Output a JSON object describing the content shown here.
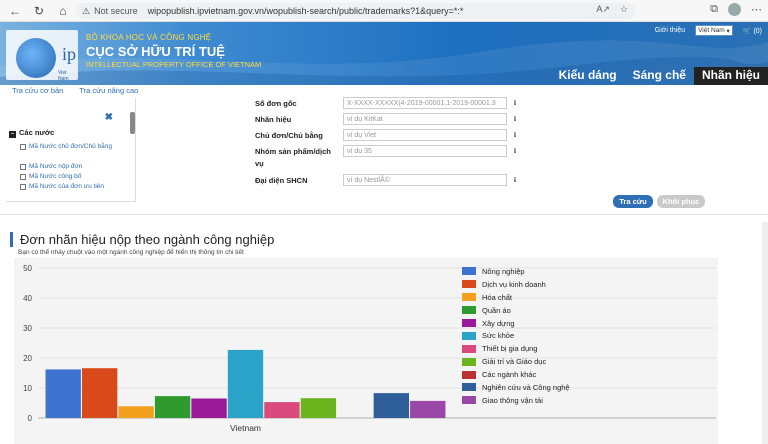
{
  "browser": {
    "not_secure": "Not secure",
    "url": "wipopublish.ipvietnam.gov.vn/wopublish-search/public/trademarks?1&query=*:*"
  },
  "header": {
    "logo_text": "ip",
    "logo_sub": "Viet Nam",
    "org_line1": "BỘ KHOA HỌC VÀ CÔNG NGHỆ",
    "org_line2": "CỤC SỞ HỮU TRÍ TUỆ",
    "org_line3": "INTELLECTUAL PROPERTY OFFICE OF VIETNAM",
    "about": "Giới thiệu",
    "language": "Việt Nam",
    "cart": "(0)",
    "tabs": [
      {
        "label": "Kiểu dáng"
      },
      {
        "label": "Sáng chế"
      },
      {
        "label": "Nhãn hiệu"
      }
    ]
  },
  "search_tabs": [
    {
      "label": "Tra cứu cơ bản"
    },
    {
      "label": "Tra cứu nâng cao"
    }
  ],
  "filter": {
    "group_label": "Các nước",
    "items": [
      {
        "label": "Mã Nước chủ đơn/Chủ bằng"
      },
      {
        "label": "Mã Nước nộp đơn"
      },
      {
        "label": "Mã Nước công bố"
      },
      {
        "label": "Mã Nước của đơn ưu tiên"
      }
    ]
  },
  "form": {
    "fields": [
      {
        "label": "Số đơn gốc",
        "placeholder": "X-XXXX-XXXXX(4-2019-00001,1-2019-00001,3"
      },
      {
        "label": "Nhãn hiệu",
        "placeholder": "ví dụ KitKat"
      },
      {
        "label": "Chủ đơn/Chủ bằng",
        "placeholder": "ví dụ Viet"
      },
      {
        "label": "Nhóm sản phẩm/dịch vụ",
        "placeholder": "ví dụ 35"
      },
      {
        "label": "Đại diện SHCN",
        "placeholder": "ví dụ NestlÃ©"
      }
    ],
    "info_glyph": "i",
    "search_button": "Tra cứu",
    "reset_button": "Khôi phục"
  },
  "chart_section": {
    "title": "Đơn nhãn hiệu nộp theo ngành công nghiệp",
    "subtitle": "Bạn có thể nháy chuột vào một ngành công nghiệp để hiển thị thông tin chi tiết"
  },
  "chart_data": {
    "type": "bar",
    "categories": [
      "Vietnam"
    ],
    "ylim": [
      0,
      50
    ],
    "yticks": [
      0,
      10,
      20,
      30,
      40,
      50
    ],
    "grid": true,
    "legend_position": "right",
    "series": [
      {
        "name": "Nông nghiệp",
        "value": 16.2,
        "color": "#3f73d1"
      },
      {
        "name": "Dịch vụ kinh doanh",
        "value": 16.6,
        "color": "#d94a1a"
      },
      {
        "name": "Hóa chất",
        "value": 3.9,
        "color": "#f2a01e"
      },
      {
        "name": "Quần áo",
        "value": 7.3,
        "color": "#2f9b2f"
      },
      {
        "name": "Xây dựng",
        "value": 6.5,
        "color": "#9a1a9a"
      },
      {
        "name": "Sức khỏe",
        "value": 22.7,
        "color": "#2ba3c9"
      },
      {
        "name": "Thiết bị gia dụng",
        "value": 5.3,
        "color": "#db4a7c"
      },
      {
        "name": "Giải trí và Giáo dục",
        "value": 6.6,
        "color": "#6bb41e"
      },
      {
        "name": "Các ngành khác",
        "value": 0,
        "color": "#b83434"
      },
      {
        "name": "Nghiên cứu và Công nghệ",
        "value": 8.3,
        "color": "#2f5f9a"
      },
      {
        "name": "Giao thông vận tải",
        "value": 5.7,
        "color": "#9a48a8"
      }
    ]
  }
}
